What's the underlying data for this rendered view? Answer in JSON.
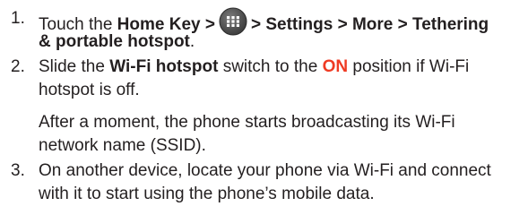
{
  "steps": [
    {
      "number": "1.",
      "line1": {
        "prefix": "Touch the ",
        "home_key": "Home Key >",
        "icon": "apps-launcher-icon",
        "path": "> Settings > More > Tethering"
      },
      "line2": {
        "path_end": "& portable hotspot",
        "period": "."
      }
    },
    {
      "number": "2.",
      "line1": {
        "prefix": "Slide the ",
        "switch_name": "Wi-Fi hotspot",
        "mid": " switch to the ",
        "state": "ON",
        "suffix": " position if Wi-Fi"
      },
      "line2": "hotspot is off.",
      "note_line1": "After a moment, the phone starts broadcasting its Wi-Fi",
      "note_line2": "network name (SSID)."
    },
    {
      "number": "3.",
      "line1": "On another device, locate your phone via Wi-Fi and connect",
      "line2": "with it to start using the phone’s mobile data."
    }
  ],
  "colors": {
    "text": "#231f20",
    "on_highlight": "#ef3b24",
    "icon_fill": "#5a5a5a"
  }
}
